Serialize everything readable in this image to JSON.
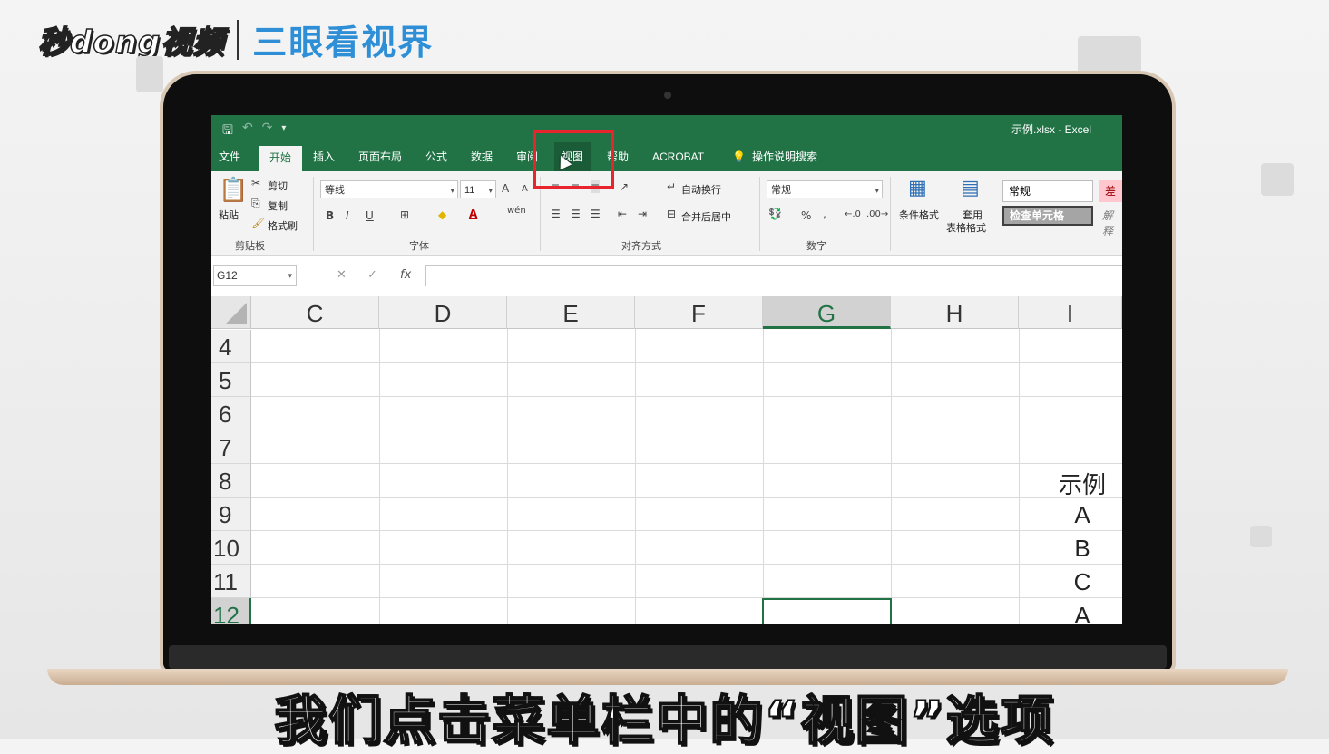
{
  "brand": {
    "logo": "秒dong视频",
    "channel": "三眼看视界"
  },
  "excel": {
    "window_title": "示例.xlsx  -  Excel",
    "qat": {
      "save": "🖫",
      "undo": "↶",
      "redo": "↷",
      "customize": "▾"
    },
    "tabs": {
      "file": "文件",
      "home": "开始",
      "insert": "插入",
      "layout": "页面布局",
      "formulas": "公式",
      "data": "数据",
      "review": "审阅",
      "view": "视图",
      "help": "帮助",
      "acrobat": "ACROBAT",
      "tell_me": "操作说明搜索"
    },
    "ribbon": {
      "clipboard": {
        "paste": "粘贴",
        "cut": "剪切",
        "copy": "复制",
        "format_painter": "格式刷",
        "label": "剪贴板"
      },
      "font": {
        "name": "等线",
        "size": "11",
        "grow": "A",
        "shrink": "A",
        "bold": "B",
        "italic": "I",
        "underline": "U",
        "label": "字体",
        "phonetic": "wén"
      },
      "alignment": {
        "wrap": "自动换行",
        "merge": "合并后居中",
        "label": "对齐方式"
      },
      "number": {
        "format": "常规",
        "percent": "%",
        "comma": ",",
        "label": "数字"
      },
      "styles": {
        "conditional": "条件格式",
        "table": "套用",
        "table2": "表格格式",
        "normal": "常规",
        "bad": "差",
        "check": "检查单元格",
        "explain": "解释"
      }
    },
    "formula_bar": {
      "name_box": "G12",
      "cancel": "✕",
      "enter": "✓",
      "fx": "fx",
      "formula": ""
    },
    "columns": [
      "C",
      "D",
      "E",
      "F",
      "G",
      "H",
      "I"
    ],
    "selected_column": "G",
    "rows": [
      "4",
      "5",
      "6",
      "7",
      "8",
      "9",
      "10",
      "11",
      "12"
    ],
    "selected_row": "12",
    "cells": {
      "I8": "示例",
      "I9": "A",
      "I10": "B",
      "I11": "C",
      "I12": "A"
    }
  },
  "subtitle": "我们点击菜单栏中的“视图”选项",
  "colors": {
    "excel_green": "#217346",
    "highlight_red": "#e8242c"
  }
}
